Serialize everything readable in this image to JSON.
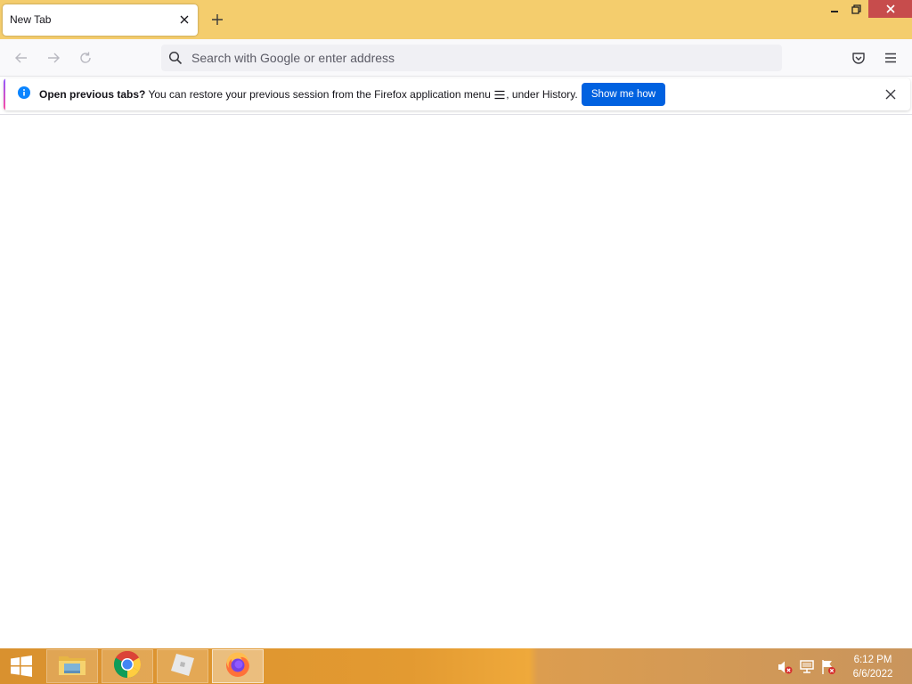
{
  "browser": {
    "tab": {
      "title": "New Tab"
    },
    "urlbar": {
      "placeholder": "Search with Google or enter address"
    }
  },
  "notification": {
    "bold_text": "Open previous tabs?",
    "text_before_icon": " You can restore your previous session from the Firefox application menu ",
    "text_after_icon": ", under History.",
    "button_label": "Show me how"
  },
  "taskbar": {
    "apps": [
      {
        "name": "File Explorer",
        "icon": "folder-icon"
      },
      {
        "name": "Google Chrome",
        "icon": "chrome-icon"
      },
      {
        "name": "Roblox",
        "icon": "roblox-icon"
      },
      {
        "name": "Firefox",
        "icon": "firefox-icon",
        "active": true
      }
    ],
    "clock": {
      "time": "6:12 PM",
      "date": "6/6/2022"
    }
  },
  "colors": {
    "titlebar": "#f4cd6d",
    "accent_button": "#0061e0",
    "close_button": "#c74c4c",
    "taskbar": "#e39a31"
  }
}
